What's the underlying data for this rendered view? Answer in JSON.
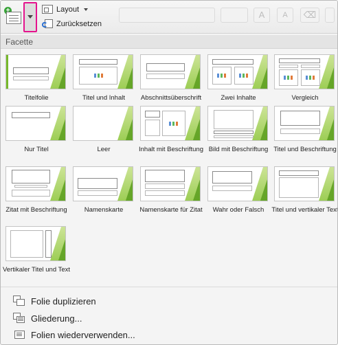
{
  "ribbon": {
    "layout_label": "Layout",
    "reset_label": "Zurücksetzen",
    "font_grow": "A",
    "font_shrink": "A"
  },
  "gallery": {
    "section_title": "Facette",
    "layouts": [
      "Titelfolie",
      "Titel und Inhalt",
      "Abschnittsüberschrift",
      "Zwei Inhalte",
      "Vergleich",
      "Nur Titel",
      "Leer",
      "Inhalt mit Beschriftung",
      "Bild mit Beschriftung",
      "Titel und Beschriftung",
      "Zitat mit Beschriftung",
      "Namenskarte",
      "Namenskarte für Zitat",
      "Wahr oder Falsch",
      "Titel und vertikaler Text",
      "Vertikaler Titel und Text"
    ]
  },
  "menu": {
    "duplicate": "Folie duplizieren",
    "outline": "Gliederung...",
    "reuse": "Folien wiederverwenden..."
  },
  "colors": {
    "accent_pink": "#e5128d",
    "theme_green": "#76b82a"
  }
}
